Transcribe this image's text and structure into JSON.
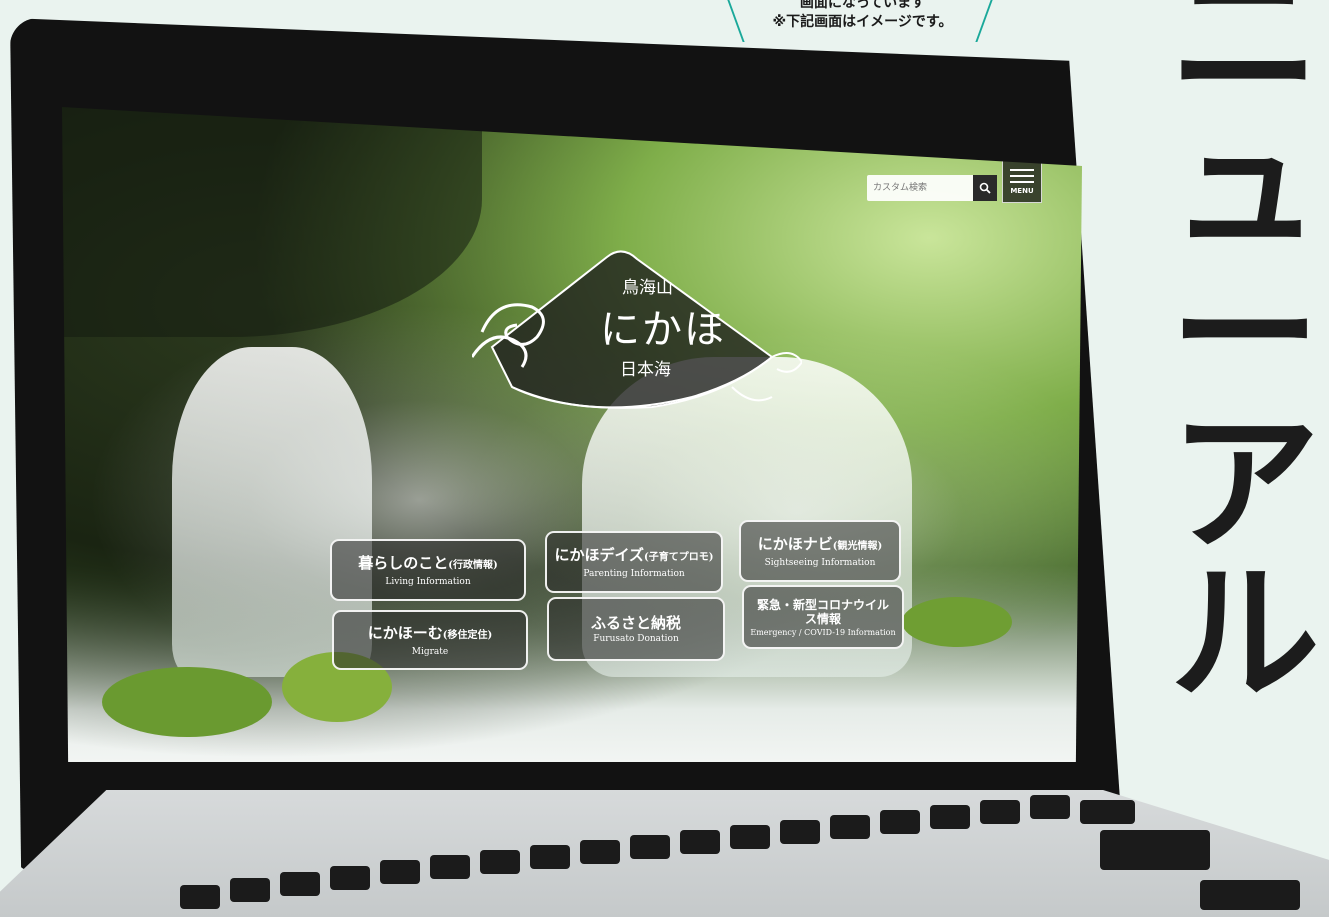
{
  "caption": {
    "line1": "画面になっています",
    "line2": "※下記画面はイメージです。"
  },
  "vertical_title": [
    "ニ",
    "ュ",
    "ー",
    "ア",
    "ル"
  ],
  "site": {
    "search": {
      "placeholder": "カスタム検索"
    },
    "menu_label": "MENU",
    "logo": {
      "top": "鳥海山",
      "main": "にかほ",
      "bottom": "日本海"
    },
    "nav": [
      {
        "ja": "暮らしのこと",
        "ja_small": "(行政情報)",
        "en": "Living Information"
      },
      {
        "ja": "にかほデイズ",
        "ja_small": "(子育てプロモ)",
        "en": "Parenting Information"
      },
      {
        "ja": "にかほナビ",
        "ja_small": "(観光情報)",
        "en": "Sightseeing Information"
      },
      {
        "ja": "にかほーむ",
        "ja_small": "(移住定住)",
        "en": "Migrate"
      },
      {
        "ja": "ふるさと納税",
        "ja_small": "",
        "en": "Furusato Donation"
      },
      {
        "ja": "緊急・新型コロナウイルス情報",
        "ja_small": "",
        "en": "Emergency / COVID-19 Information"
      }
    ]
  },
  "colors": {
    "accent_teal": "#1aa89a",
    "background": "#eaf3ef"
  },
  "icons": {
    "search": "search-icon",
    "menu": "hamburger-icon"
  }
}
